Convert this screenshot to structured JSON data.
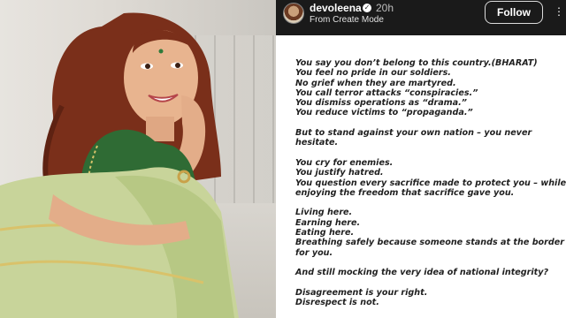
{
  "header": {
    "username": "devoleena",
    "time": "20h",
    "subtitle": "From Create Mode",
    "follow_label": "Follow",
    "icons": {
      "verified": "verified-badge-icon",
      "more": "more-options-icon"
    }
  },
  "photo": {
    "description_icon": "portrait-photo"
  },
  "post_lines": [
    "You say you don’t belong to this country.(BHARAT)",
    "You feel no pride in our soldiers.",
    "No grief when they are martyred.",
    "You call terror attacks “conspiracies.”",
    "You dismiss operations as “drama.”",
    "You reduce victims to “propaganda.”",
    "",
    "But  to stand against your own nation – you never",
    "hesitate.",
    "",
    "You cry for enemies.",
    "You justify hatred.",
    "You question every sacrifice made to protect you – while",
    "enjoying the freedom that sacrifice gave you.",
    "",
    "Living here.",
    "Earning here.",
    "Eating here.",
    "Breathing safely because someone stands at the border",
    "for you.",
    "",
    "And still mocking the very idea of national integrity?",
    "",
    "Disagreement is your right.",
    "Disrespect is not."
  ],
  "colors": {
    "header_bg": "#1a1a1a",
    "post_bg": "#ffffff",
    "text": "#1f1f1f"
  }
}
